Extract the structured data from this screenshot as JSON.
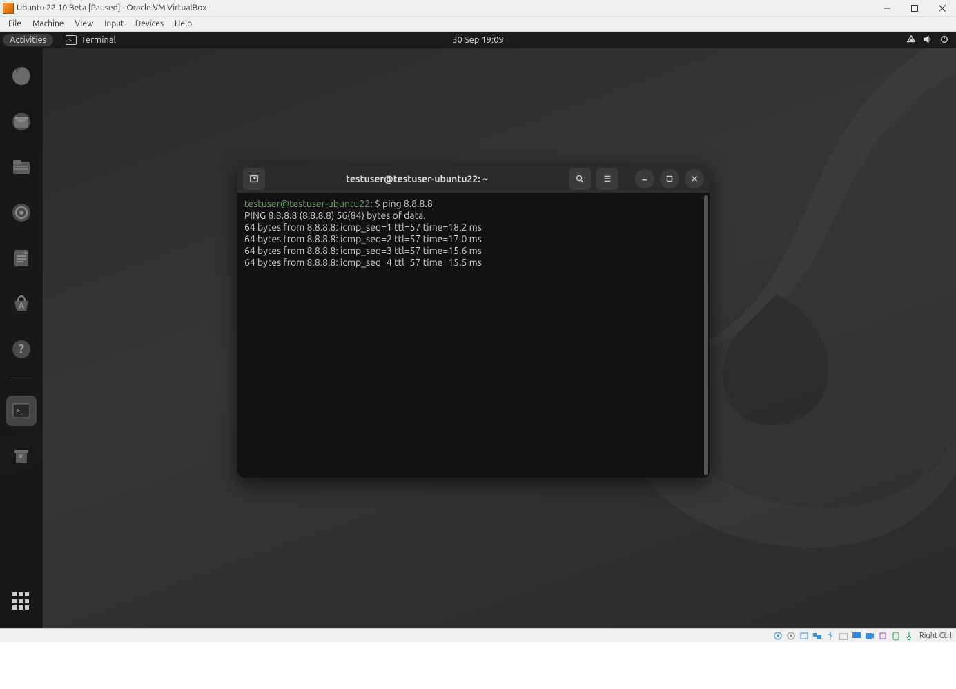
{
  "vb": {
    "title": "Ubuntu 22.10 Beta [Paused] - Oracle VM VirtualBox",
    "menu": [
      "File",
      "Machine",
      "View",
      "Input",
      "Devices",
      "Help"
    ],
    "hostkey": "Right Ctrl"
  },
  "topbar": {
    "activities": "Activities",
    "app_label": "Terminal",
    "clock": "30 Sep  19:09"
  },
  "dock_icons": [
    "firefox",
    "thunderbird",
    "files",
    "rhythmbox",
    "libreoffice-writer",
    "software",
    "help"
  ],
  "terminal": {
    "title": "testuser@testuser-ubuntu22: ~",
    "prompt_user": "testuser@testuser-ubuntu22",
    "prompt_sep": ": ",
    "prompt_mark": "$ ",
    "command": "ping 8.8.8.8",
    "lines": [
      "PING 8.8.8.8 (8.8.8.8) 56(84) bytes of data.",
      "64 bytes from 8.8.8.8: icmp_seq=1 ttl=57 time=18.2 ms",
      "64 bytes from 8.8.8.8: icmp_seq=2 ttl=57 time=17.0 ms",
      "64 bytes from 8.8.8.8: icmp_seq=3 ttl=57 time=15.6 ms",
      "64 bytes from 8.8.8.8: icmp_seq=4 ttl=57 time=15.5 ms"
    ]
  }
}
